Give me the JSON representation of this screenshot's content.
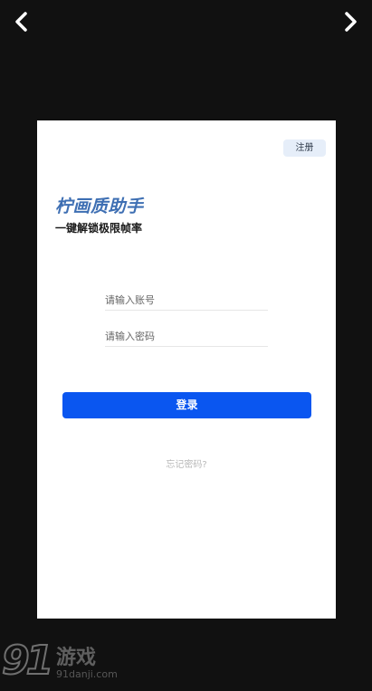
{
  "viewer": {
    "prev_icon": "chevron-left-icon",
    "next_icon": "chevron-right-icon"
  },
  "login_screen": {
    "register_label": "注册",
    "app_title": "柠画质助手",
    "subtitle": "一键解锁极限帧率",
    "account_placeholder": "请输入账号",
    "password_placeholder": "请输入密码",
    "login_label": "登录",
    "forgot_label": "忘记密码?",
    "accent_color": "#0a56f0"
  },
  "watermark": {
    "number": "91",
    "brand": "游戏",
    "url": "91danji.com"
  }
}
